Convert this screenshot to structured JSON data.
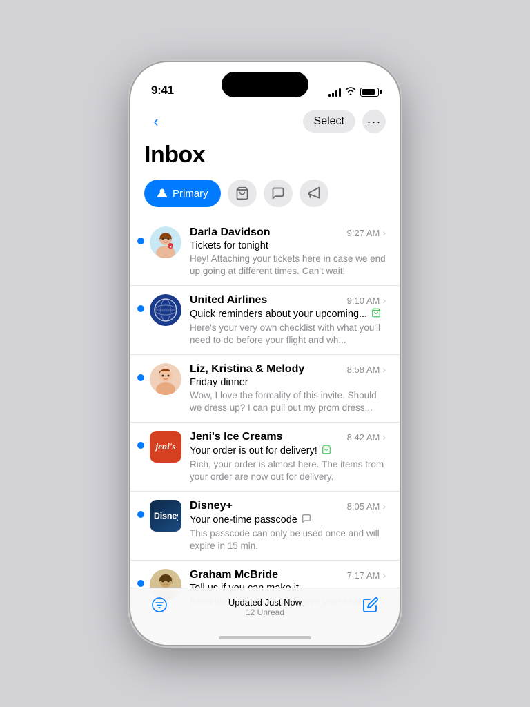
{
  "phone": {
    "time": "9:41",
    "signal_bars": [
      4,
      6,
      8,
      10,
      12
    ],
    "battery_level": 85
  },
  "nav": {
    "back_label": "‹",
    "select_label": "Select",
    "more_label": "···"
  },
  "header": {
    "title": "Inbox"
  },
  "tabs": [
    {
      "id": "primary",
      "label": "Primary",
      "icon": "👤",
      "active": true
    },
    {
      "id": "shopping",
      "label": "",
      "icon": "🛒",
      "active": false
    },
    {
      "id": "social",
      "label": "",
      "icon": "💬",
      "active": false
    },
    {
      "id": "promotions",
      "label": "",
      "icon": "📣",
      "active": false
    }
  ],
  "emails": [
    {
      "sender": "Darla Davidson",
      "subject": "Tickets for tonight",
      "preview": "Hey! Attaching your tickets here in case we end up going at different times. Can't wait!",
      "time": "9:27 AM",
      "unread": true,
      "avatar_type": "darla",
      "category_icon": ""
    },
    {
      "sender": "United Airlines",
      "subject": "Quick reminders about your upcoming...",
      "preview": "Here's your very own checklist with what you'll need to do before your flight and wh...",
      "time": "9:10 AM",
      "unread": true,
      "avatar_type": "united",
      "category_icon": "cart"
    },
    {
      "sender": "Liz, Kristina & Melody",
      "subject": "Friday dinner",
      "preview": "Wow, I love the formality of this invite. Should we dress up? I can pull out my prom dress...",
      "time": "8:58 AM",
      "unread": true,
      "avatar_type": "liz",
      "category_icon": ""
    },
    {
      "sender": "Jeni's Ice Creams",
      "subject": "Your order is out for delivery!",
      "preview": "Rich, your order is almost here. The items from your order are now out for delivery.",
      "time": "8:42 AM",
      "unread": true,
      "avatar_type": "jenis",
      "category_icon": "cart"
    },
    {
      "sender": "Disney+",
      "subject": "Your one-time passcode",
      "preview": "This passcode can only be used once and will expire in 15 min.",
      "time": "8:05 AM",
      "unread": true,
      "avatar_type": "disney",
      "category_icon": "chat"
    },
    {
      "sender": "Graham McBride",
      "subject": "Tell us if you can make it",
      "preview": "Reminder to RSVP and reserve your seat at",
      "time": "7:17 AM",
      "unread": true,
      "avatar_type": "graham",
      "category_icon": ""
    }
  ],
  "toolbar": {
    "updated_text": "Updated Just Now",
    "unread_text": "12 Unread",
    "filter_icon": "filter",
    "compose_icon": "compose"
  }
}
